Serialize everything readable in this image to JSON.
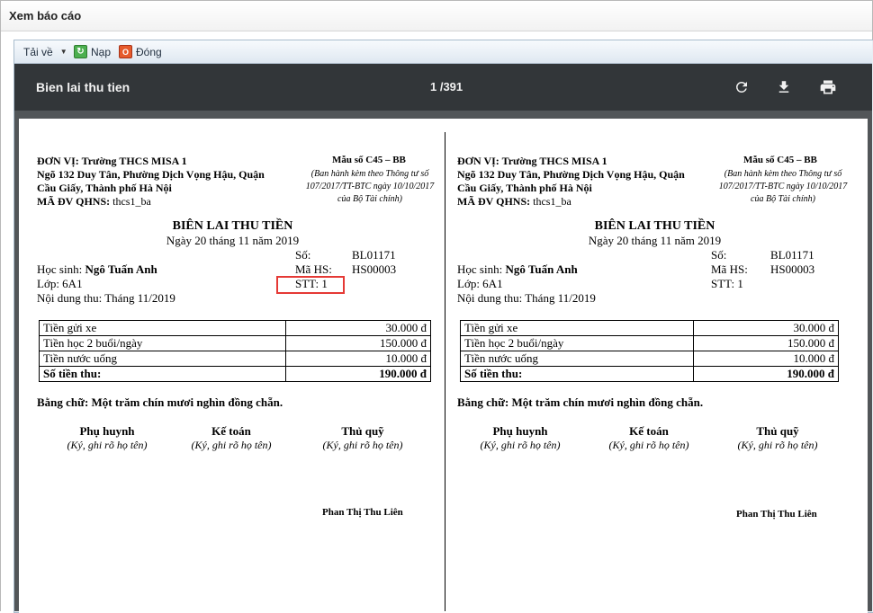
{
  "window": {
    "title": "Xem báo cáo"
  },
  "toolbar": {
    "download_label": "Tải về",
    "reload_label": "Nạp",
    "close_label": "Đóng"
  },
  "viewer": {
    "document_title": "Bien lai thu tien",
    "page_indicator": "1 /391"
  },
  "receipts": [
    {
      "org_unit_label": "ĐƠN VỊ:",
      "org_unit": "Trường THCS MISA 1",
      "address_1": "Ngõ 132 Duy Tân, Phường Dịch Vọng Hậu, Quận",
      "address_2": "Cầu Giấy, Thành phố Hà Nội",
      "qhns_label": "MÃ ĐV QHNS:",
      "qhns": "thcs1_ba",
      "form_code": "Mẫu số C45 – BB",
      "form_note_1": "(Ban hành kèm theo Thông tư số",
      "form_note_2": "107/2017/TT-BTC ngày 10/10/2017",
      "form_note_3": "của Bộ Tài chính)",
      "title": "BIÊN LAI THU TIỀN",
      "date": "Ngày 20 tháng 11 năm 2019",
      "number_label": "Số:",
      "number": "BL01171",
      "student_id_label": "Mã HS:",
      "student_id": "HS00003",
      "stt_text": "STT: 1",
      "student_label": "Học sinh:",
      "student_name": "Ngô Tuấn Anh",
      "class_text": "Lớp: 6A1",
      "content_text": "Nội dung thu: Tháng 11/2019",
      "fees": [
        {
          "name": "Tiền gửi xe",
          "amount": "30.000 đ"
        },
        {
          "name": "Tiền học 2 buổi/ngày",
          "amount": "150.000 đ"
        },
        {
          "name": "Tiền nước uống",
          "amount": "10.000 đ"
        }
      ],
      "total_label": "Số tiền thu:",
      "total": "190.000 đ",
      "words": "Bằng chữ: Một trăm chín mươi nghìn đồng chẵn.",
      "sig_parent": "Phụ huynh",
      "sig_accountant": "Kế toán",
      "sig_cashier": "Thủ quỹ",
      "sig_note": "(Ký, ghi rõ họ tên)",
      "signer_name": "Phan Thị Thu Liên"
    },
    {
      "org_unit_label": "ĐƠN VỊ:",
      "org_unit": "Trường THCS MISA 1",
      "address_1": "Ngõ 132 Duy Tân, Phường Dịch Vọng Hậu, Quận",
      "address_2": "Cầu Giấy, Thành phố Hà Nội",
      "qhns_label": "MÃ ĐV QHNS:",
      "qhns": "thcs1_ba",
      "form_code": "Mẫu số C45 – BB",
      "form_note_1": "(Ban hành kèm theo Thông tư số",
      "form_note_2": "107/2017/TT-BTC ngày 10/10/2017",
      "form_note_3": "của Bộ Tài chính)",
      "title": "BIÊN LAI THU TIỀN",
      "date": "Ngày 20 tháng 11 năm 2019",
      "number_label": "Số:",
      "number": "BL01171",
      "student_id_label": "Mã HS:",
      "student_id": "HS00003",
      "stt_text": "STT: 1",
      "student_label": "Học sinh:",
      "student_name": "Ngô Tuấn Anh",
      "class_text": "Lớp: 6A1",
      "content_text": "Nội dung thu: Tháng 11/2019",
      "fees": [
        {
          "name": "Tiền gửi xe",
          "amount": "30.000 đ"
        },
        {
          "name": "Tiền học 2 buổi/ngày",
          "amount": "150.000 đ"
        },
        {
          "name": "Tiền nước uống",
          "amount": "10.000 đ"
        }
      ],
      "total_label": "Số tiền thu:",
      "total": "190.000 đ",
      "words": "Bằng chữ: Một trăm chín mươi nghìn đồng chẵn.",
      "sig_parent": "Phụ huynh",
      "sig_accountant": "Kế toán",
      "sig_cashier": "Thủ quỹ",
      "sig_note": "(Ký, ghi rõ họ tên)",
      "signer_name": "Phan Thị Thu Liên"
    }
  ],
  "colors": {
    "viewer_bar": "#323639",
    "highlight": "#e53935"
  },
  "icons": {
    "rotate": "rotate-icon",
    "download": "download-icon",
    "print": "print-icon"
  }
}
